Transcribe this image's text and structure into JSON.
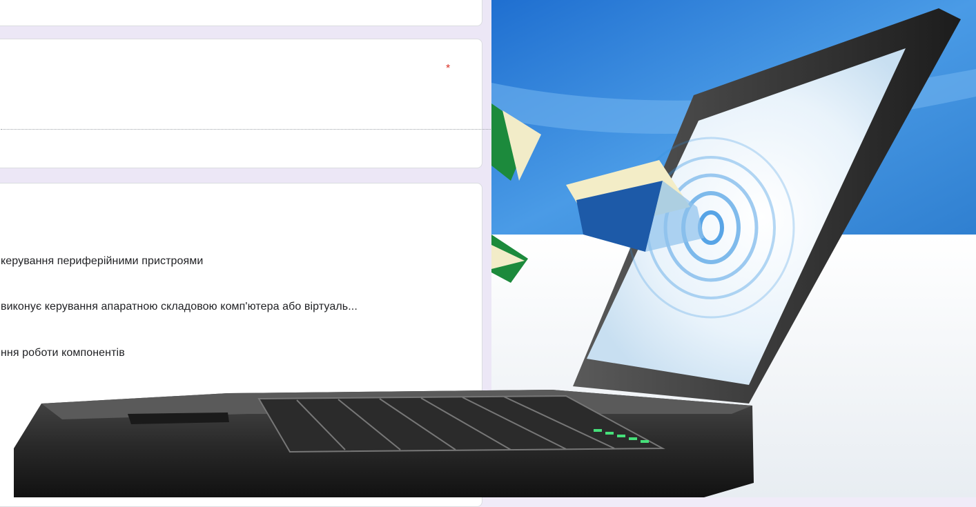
{
  "form": {
    "required_mark": "*",
    "options": [
      "керування периферійними пристроями",
      "виконує керування апаратною складовою комп'ютера або віртуаль...",
      "ння роботи компонентів"
    ]
  },
  "colors": {
    "form_background": "#ece7f6",
    "card": "#ffffff",
    "required": "#d93025",
    "sky": "#2f7fd0",
    "laptop_body": "#2a2a2a",
    "book_cover": "#1d5aa8",
    "book_green": "#1c8a3c"
  },
  "icons": [
    "laptop-illustration",
    "book-icon",
    "ripple-icon"
  ]
}
